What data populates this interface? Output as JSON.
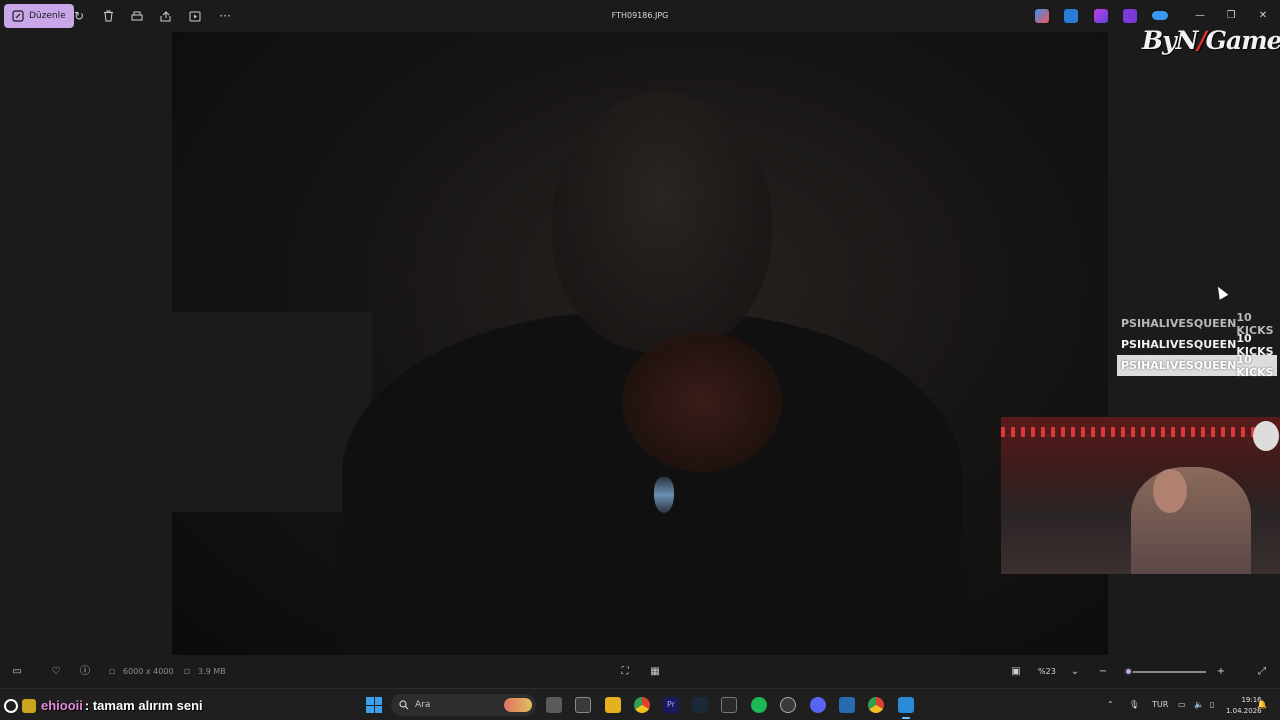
{
  "window": {
    "edit_label": "Düzenle",
    "file_name": "FTH09186.JPG"
  },
  "toolbar_icons": [
    "rotate-icon",
    "delete-icon",
    "print-icon",
    "share-icon",
    "slideshow-icon",
    "more-icon"
  ],
  "overlay": {
    "logo_text_1": "ByN",
    "logo_slash": "/",
    "logo_text_2": "Game",
    "kicks": [
      {
        "user": "PSIHALIVESQUEEN",
        "amount": "10 KICKS"
      },
      {
        "user": "PSIHALIVESQUEEN",
        "amount": "10 KICKS"
      },
      {
        "user": "PSIHALIVESQUEEN",
        "amount": "10 KICKS"
      }
    ]
  },
  "status": {
    "dimensions": "6000 x 4000",
    "file_size": "3.9 MB",
    "zoom": "%23",
    "zoom_level": 0.05
  },
  "chat": {
    "user": "ehiooii",
    "message": " : tamam alırım seni"
  },
  "taskbar": {
    "search_placeholder": "Ara",
    "language": "TUR",
    "time": "19:16",
    "date": "1.04.2026"
  },
  "colors": {
    "accent": "#c9a6e8",
    "window_bg": "#1b1b1b",
    "chat_user": "#e08ad8"
  }
}
